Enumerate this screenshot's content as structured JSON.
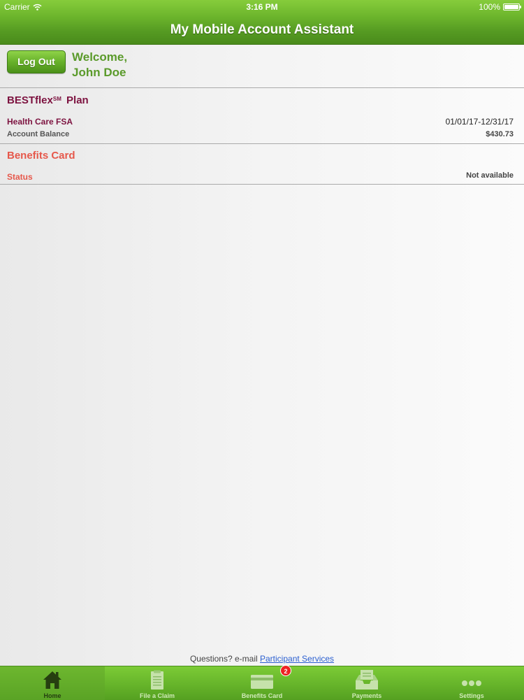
{
  "status_bar": {
    "carrier": "Carrier",
    "time": "3:16 PM",
    "battery": "100%"
  },
  "nav": {
    "title": "My Mobile Account Assistant"
  },
  "welcome": {
    "logout_label": "Log Out",
    "line1": "Welcome,",
    "line2": "John Doe"
  },
  "plan": {
    "title": "BESTflex",
    "title_mark": "SM",
    "title_suffix": " Plan",
    "account_name": "Health Care FSA",
    "period": "01/01/17-12/31/17",
    "balance_label": "Account Balance",
    "balance_value": "$430.73"
  },
  "benefits_card": {
    "title": "Benefits Card",
    "status_label": "Status",
    "status_value": "Not available"
  },
  "footer": {
    "question": "Questions? e-mail ",
    "link": "Participant Services"
  },
  "tabbar": {
    "tabs": [
      {
        "label": "Home",
        "icon": "home-icon",
        "active": true
      },
      {
        "label": "File a Claim",
        "icon": "document-icon"
      },
      {
        "label": "Benefits Card",
        "icon": "card-icon",
        "badge": "2"
      },
      {
        "label": "Payments",
        "icon": "inbox-icon"
      },
      {
        "label": "Settings",
        "icon": "more-icon"
      }
    ]
  },
  "colors": {
    "brand_green": "#5a9a2a",
    "plan_maroon": "#7d1340",
    "card_red": "#e6584b"
  }
}
